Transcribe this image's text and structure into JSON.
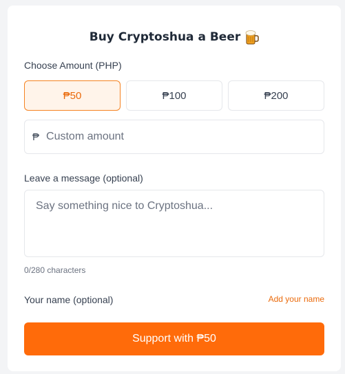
{
  "header": {
    "title": "Buy Cryptoshua a Beer",
    "icon": "beer-mug-icon"
  },
  "amount": {
    "label": "Choose Amount (PHP)",
    "options": [
      "₱50",
      "₱100",
      "₱200"
    ],
    "selected": "₱50",
    "currency_symbol": "₱",
    "custom_placeholder": "Custom amount"
  },
  "message": {
    "label": "Leave a message (optional)",
    "placeholder": "Say something nice to Cryptoshua...",
    "counter": "0/280 characters"
  },
  "name": {
    "label": "Your name (optional)",
    "add_link": "Add your name"
  },
  "submit": {
    "label": "Support with ₱50"
  },
  "colors": {
    "accent": "#ff6b0a",
    "selected_bg": "#fff4ea",
    "selected_border": "#f58220"
  }
}
